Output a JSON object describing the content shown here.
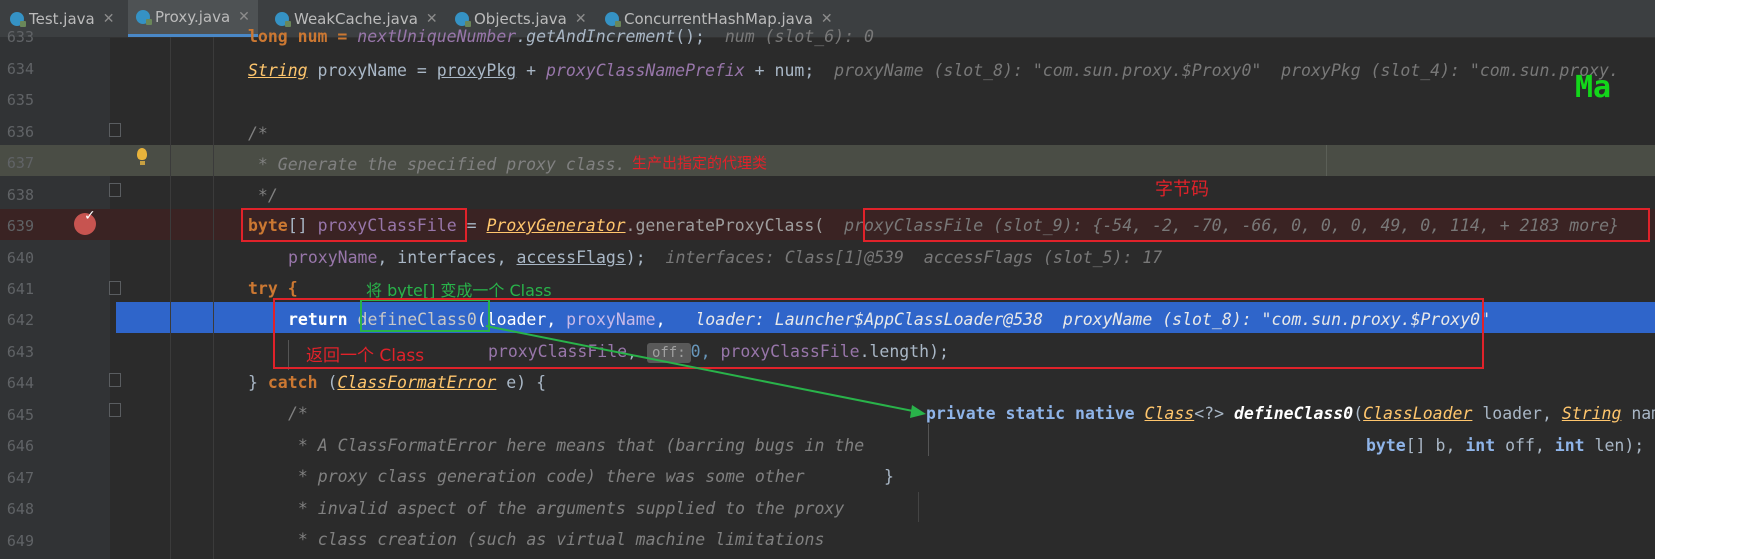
{
  "tabs": [
    {
      "label": "Test.java"
    },
    {
      "label": "Proxy.java"
    },
    {
      "label": "WeakCache.java"
    },
    {
      "label": "Objects.java"
    },
    {
      "label": "ConcurrentHashMap.java"
    }
  ],
  "line_numbers": [
    "633",
    "634",
    "635",
    "636",
    "637",
    "638",
    "639",
    "640",
    "641",
    "642",
    "643",
    "644",
    "645",
    "646",
    "647",
    "648",
    "649"
  ],
  "code": {
    "l633_a": "long num = ",
    "l633_b": "nextUniqueNumber",
    "l633_c": ".getAndIncrement",
    "l633_d": "();",
    "l633_hint": "num (slot_6): 0",
    "l634_type": "String",
    "l634_a": " proxyName = ",
    "l634_b": "proxyPkg",
    "l634_c": " + ",
    "l634_d": "proxyClassNamePrefix",
    "l634_e": " + num;",
    "l634_hint": "proxyName (slot_8): \"com.sun.proxy.$Proxy0\"  proxyPkg (slot_4): \"com.sun.proxy.",
    "l636": "/*",
    "l637": " * Generate the specified proxy class.",
    "l638": " */",
    "l639_a": "byte",
    "l639_b": "[] ",
    "l639_c": "proxyClassFile",
    "l639_d": " = ",
    "l639_e": "ProxyGenerator",
    "l639_f": ".generateProxyClass(",
    "l639_hint": "proxyClassFile (slot_9): {-54, -2, -70, -66, 0, 0, 0, 49, 0, 114, + 2183 more}",
    "l640_a": "proxyName",
    "l640_b": ", interfaces, ",
    "l640_c": "accessFlags",
    "l640_d": ");",
    "l640_hint": "interfaces: Class[1]@539  accessFlags (slot_5): 17",
    "l641": "try {",
    "l642_a": "return ",
    "l642_b": "defineClass0",
    "l642_c": "(loader, ",
    "l642_d": "proxyName",
    "l642_e": ",",
    "l642_hint": "loader: Launcher$AppClassLoader@538  proxyName (slot_8): \"com.sun.proxy.$Proxy0\"",
    "l643_a": "proxyClassFile",
    "l643_b": ", ",
    "l643_off": "off:",
    "l643_c": "0, ",
    "l643_d": "proxyClassFile",
    "l643_e": ".length);",
    "l644_a": "} ",
    "l644_b": "catch",
    "l644_c": " (",
    "l644_d": "ClassFormatError",
    "l644_e": " e) {",
    "l645": "/*",
    "l646": " * A ClassFormatError here means that (barring bugs in the",
    "l647": " * proxy class generation code) there was some other",
    "l648": " * invalid aspect of the arguments supplied to the proxy",
    "l649": " * class creation (such as virtual machine limitations"
  },
  "popup": {
    "l1_a": "private static native ",
    "l1_b": "Class",
    "l1_c": "<?> ",
    "l1_d": "defineClass0",
    "l1_e": "(",
    "l1_f": "ClassLoader",
    "l1_g": " loader, ",
    "l1_h": "String",
    "l1_i": " name,",
    "l2_a": "byte",
    "l2_b": "[] b, ",
    "l2_c": "int",
    "l2_d": " off, ",
    "l2_e": "int",
    "l2_f": " len);",
    "brace": "}"
  },
  "annotations": {
    "generate": "生产出指定的代理类",
    "bytecode": "字节码",
    "to_class": "将 byte[] 变成一个 Class",
    "return_class": "返回一个 Class"
  },
  "minimap_text": "Ma",
  "colors": {
    "red_box": "#e0222a",
    "green_box": "#29b34a",
    "selected_line": "#2f65ca",
    "breakpoint": "#c75450"
  }
}
